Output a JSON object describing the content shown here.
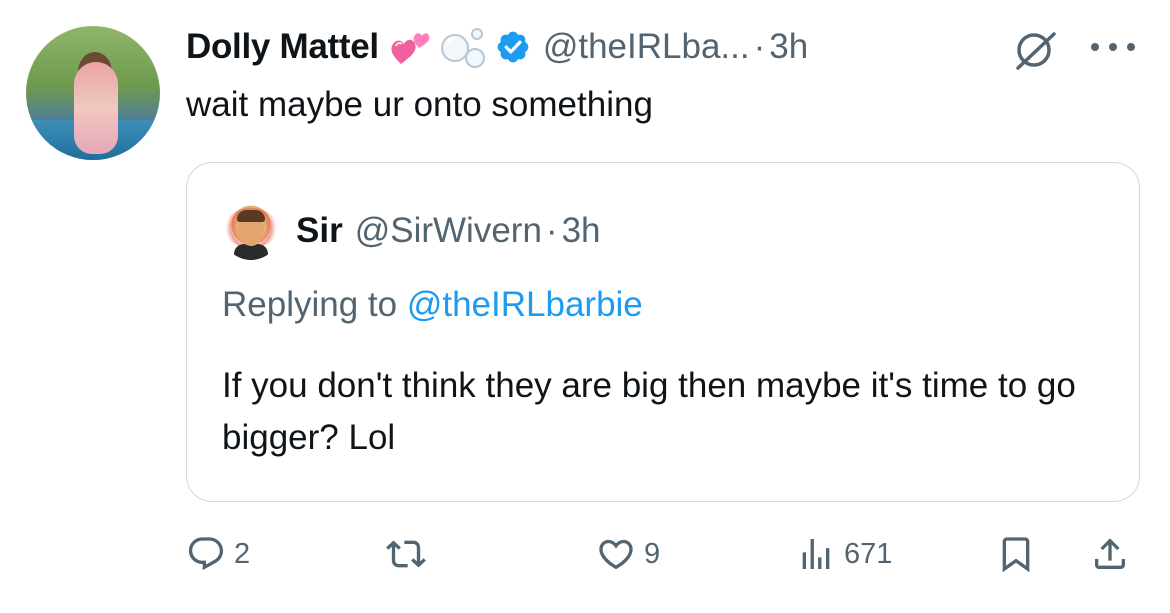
{
  "tweet": {
    "display_name": "Dolly Mattel",
    "handle": "@theIRLba...",
    "dot": "·",
    "time": "3h",
    "text": "wait maybe ur onto something"
  },
  "quoted": {
    "display_name": "Sir",
    "handle": "@SirWivern",
    "dot": "·",
    "time": "3h",
    "replying_prefix": "Replying to ",
    "replying_mention": "@theIRLbarbie",
    "text": "If you don't think they are big then maybe it's time to go bigger? Lol"
  },
  "actions": {
    "reply_count": "2",
    "like_count": "9",
    "views_count": "671"
  },
  "colors": {
    "text": "#0f1419",
    "secondary": "#536471",
    "link": "#1d9bf0",
    "border": "#cfd9de",
    "heart_emoji": "#f0609e"
  },
  "icons": [
    "verified-badge-icon",
    "grok-icon",
    "more-icon",
    "reply-icon",
    "retweet-icon",
    "like-icon",
    "views-icon",
    "bookmark-icon",
    "share-icon"
  ]
}
